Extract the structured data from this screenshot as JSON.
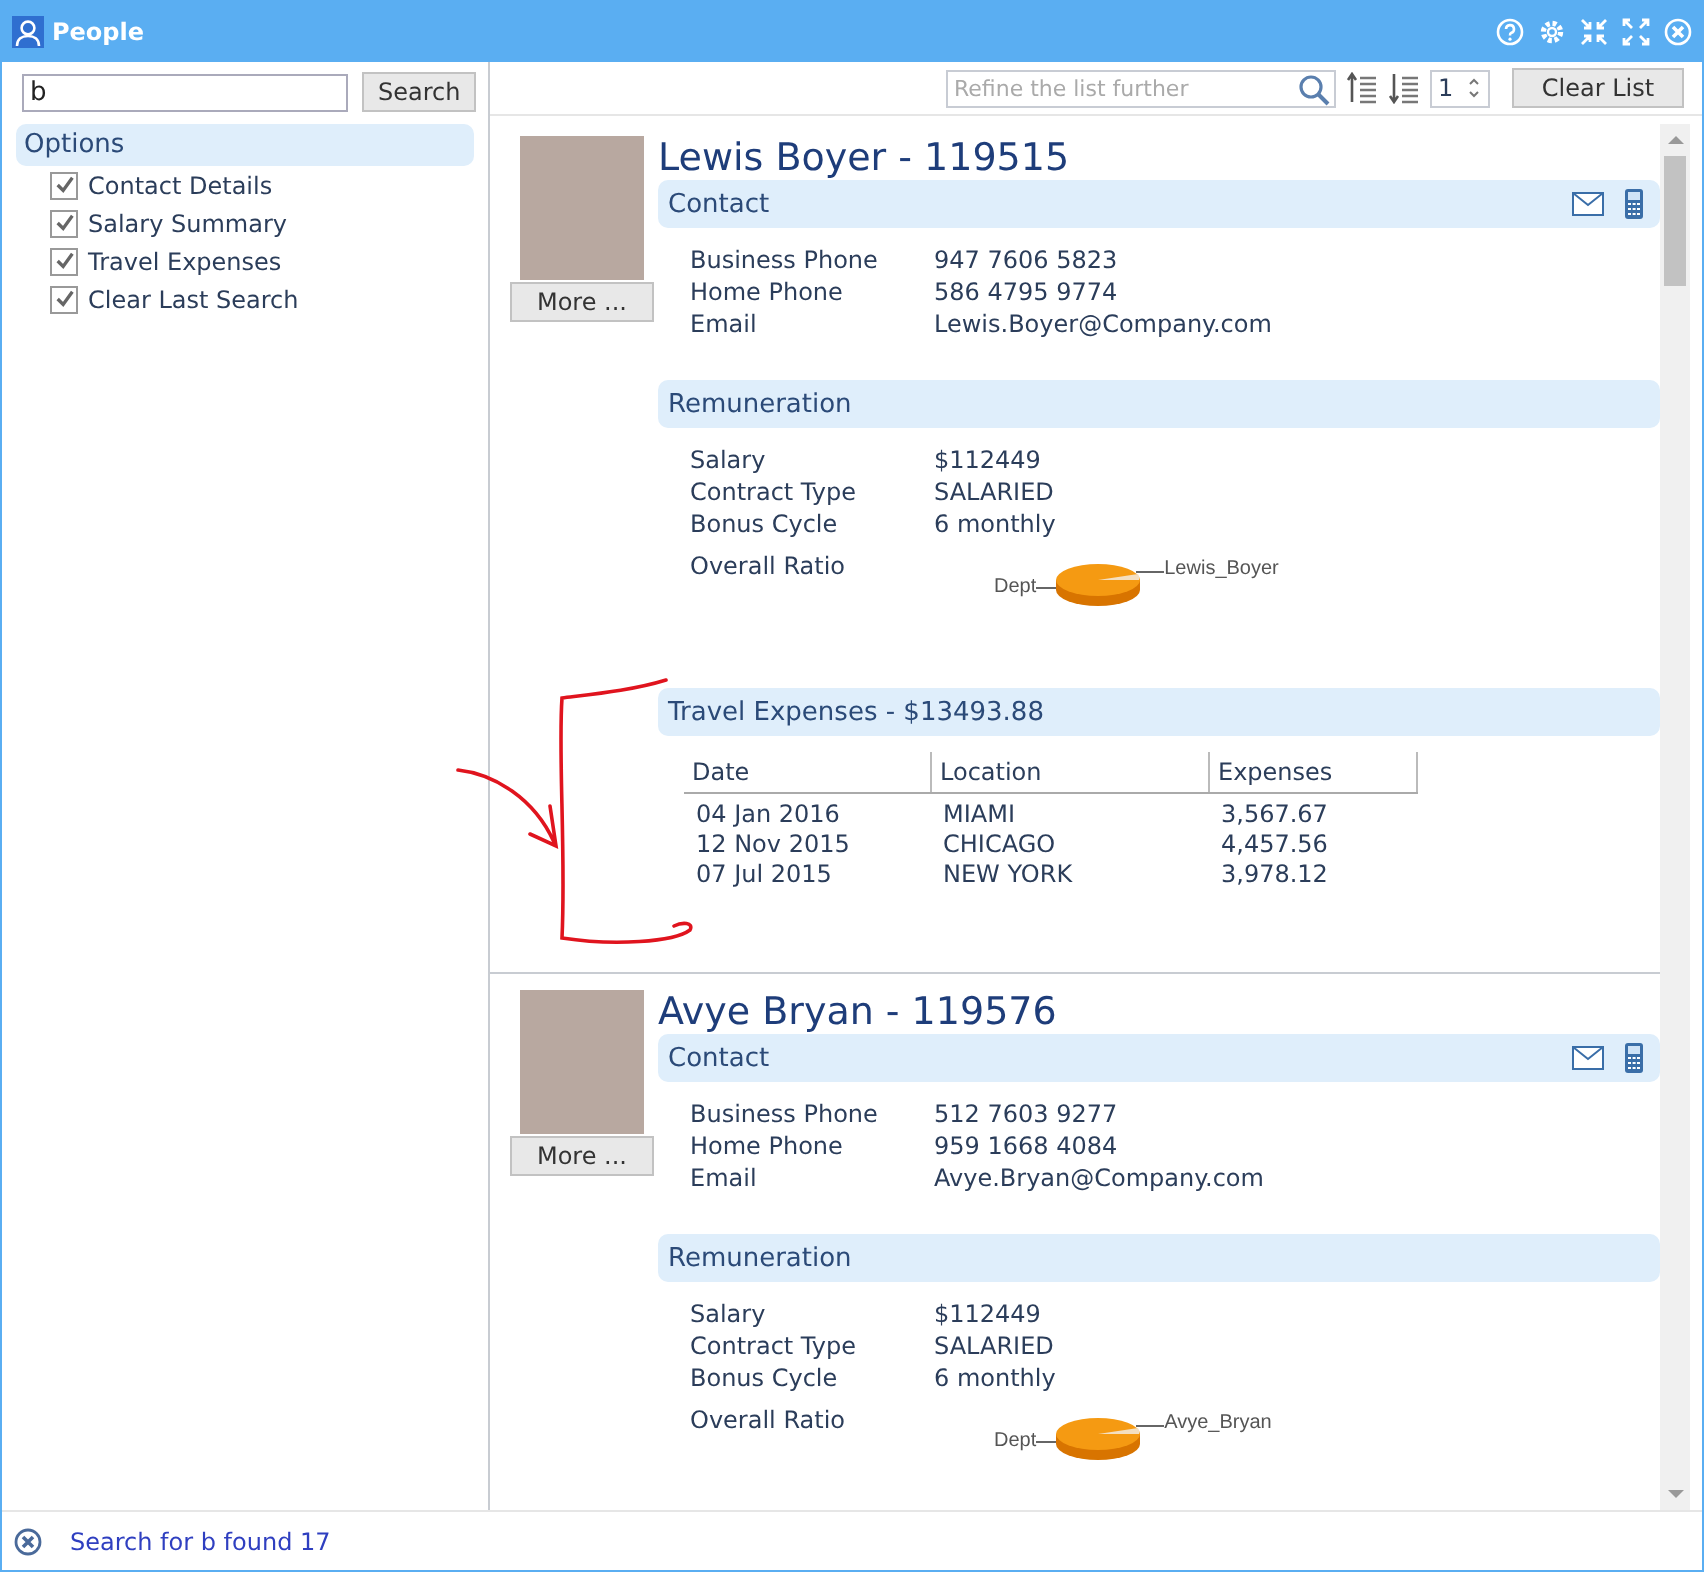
{
  "window": {
    "title": "People"
  },
  "search": {
    "value": "b",
    "button": "Search"
  },
  "options": {
    "title": "Options",
    "items": [
      {
        "label": "Contact Details",
        "checked": true
      },
      {
        "label": "Salary Summary",
        "checked": true
      },
      {
        "label": "Travel Expenses",
        "checked": true
      },
      {
        "label": "Clear Last Search",
        "checked": true
      }
    ]
  },
  "toolbar": {
    "refine_placeholder": "Refine the list further",
    "page": "1",
    "clear_button": "Clear List"
  },
  "people": [
    {
      "name": "Lewis Boyer - 119515",
      "more_button": "More ...",
      "contact": {
        "title": "Contact",
        "fields": [
          {
            "label": "Business Phone",
            "value": "947 7606 5823"
          },
          {
            "label": "Home Phone",
            "value": "586 4795 9774"
          },
          {
            "label": "Email",
            "value": "Lewis.Boyer@Company.com"
          }
        ]
      },
      "remuneration": {
        "title": "Remuneration",
        "fields": [
          {
            "label": "Salary",
            "value": "$112449"
          },
          {
            "label": "Contract Type",
            "value": "SALARIED"
          },
          {
            "label": "Bonus Cycle",
            "value": "6 monthly"
          }
        ],
        "ratio_label": "Overall Ratio",
        "pie_labels": [
          "Dept",
          "Lewis_Boyer"
        ]
      },
      "travel": {
        "title": "Travel Expenses - $13493.88",
        "columns": [
          "Date",
          "Location",
          "Expenses"
        ],
        "rows": [
          [
            "04 Jan 2016",
            "MIAMI",
            "3,567.67"
          ],
          [
            "12 Nov 2015",
            "CHICAGO",
            "4,457.56"
          ],
          [
            "07 Jul 2015",
            "NEW YORK",
            "3,978.12"
          ]
        ]
      }
    },
    {
      "name": "Avye Bryan - 119576",
      "more_button": "More ...",
      "contact": {
        "title": "Contact",
        "fields": [
          {
            "label": "Business Phone",
            "value": "512 7603 9277"
          },
          {
            "label": "Home Phone",
            "value": "959 1668 4084"
          },
          {
            "label": "Email",
            "value": "Avye.Bryan@Company.com"
          }
        ]
      },
      "remuneration": {
        "title": "Remuneration",
        "fields": [
          {
            "label": "Salary",
            "value": "$112449"
          },
          {
            "label": "Contract Type",
            "value": "SALARIED"
          },
          {
            "label": "Bonus Cycle",
            "value": "6 monthly"
          }
        ],
        "ratio_label": "Overall Ratio",
        "pie_labels": [
          "Dept",
          "Avye_Bryan"
        ]
      }
    }
  ],
  "status_bar": {
    "text": "Search for b found 17"
  }
}
